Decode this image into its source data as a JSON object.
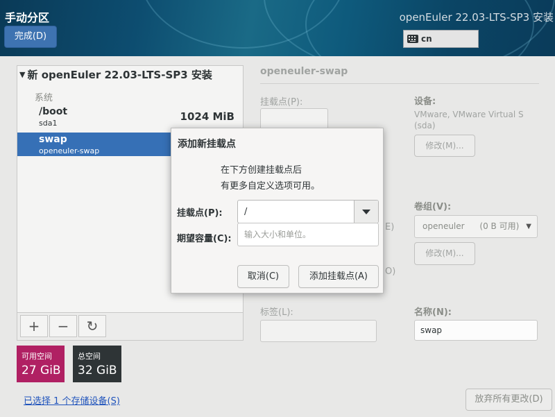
{
  "header": {
    "page_title": "手动分区",
    "done_button": "完成(D)",
    "install_title": "openEuler 22.03-LTS-SP3 安装",
    "keyboard_layout": "cn"
  },
  "partition_tree": {
    "root_label": "新 openEuler 22.03-LTS-SP3 安装",
    "group_label": "系统",
    "partitions": [
      {
        "name": "/boot",
        "device": "sda1",
        "size": "1024 MiB",
        "selected": false
      },
      {
        "name": "swap",
        "device": "openeuler-swap",
        "size": "",
        "selected": true
      }
    ],
    "toolbar": {
      "add": "+",
      "remove": "−",
      "refresh": "↻"
    }
  },
  "space": {
    "available_label": "可用空间",
    "available_value": "27 GiB",
    "total_label": "总空间",
    "total_value": "32 GiB"
  },
  "storage_link": "已选择 1 个存储设备(S)",
  "details": {
    "title": "openeuler-swap",
    "mount_point_label": "挂载点(P):",
    "device_label": "设备:",
    "device_value": "VMware, VMware Virtual S (sda)",
    "modify_button": "修改(M)...",
    "volume_group_label": "卷组(V):",
    "volume_group_value": "openeuler",
    "volume_group_free": "(0 B 可用)",
    "modify_button_2": "修改(M)...",
    "hidden_letter_e": "E)",
    "hidden_letter_o": "O)",
    "tag_label": "标签(L):",
    "name_label": "名称(N):",
    "name_value": "swap",
    "discard_button": "放弃所有更改(D)"
  },
  "dialog": {
    "title": "添加新挂载点",
    "message_line1": "在下方创建挂载点后",
    "message_line2": "有更多自定义选项可用。",
    "mount_point_label": "挂载点(P):",
    "mount_point_value": "/",
    "capacity_label": "期望容量(C):",
    "capacity_placeholder": "输入大小和单位。",
    "cancel_button": "取消(C)",
    "add_button": "添加挂载点(A)"
  },
  "colors": {
    "header_bg": "#0d4d70",
    "accent": "#3670b6",
    "available_tile": "#b02063",
    "total_tile": "#2e3436"
  }
}
